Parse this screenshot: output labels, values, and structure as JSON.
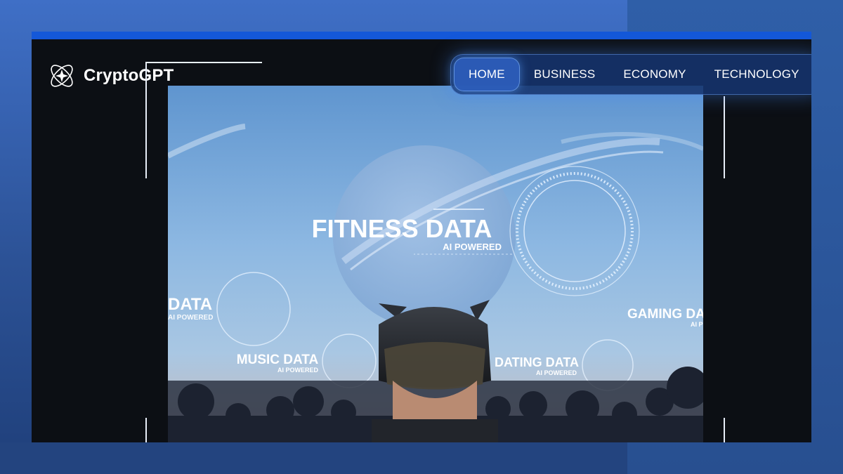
{
  "brand": {
    "name": "CryptoGPT",
    "logo_icon": "atom-star-icon"
  },
  "nav": {
    "items": [
      {
        "label": "HOME",
        "active": true
      },
      {
        "label": "BUSINESS",
        "active": false
      },
      {
        "label": "ECONOMY",
        "active": false
      },
      {
        "label": "TECHNOLOGY",
        "active": false
      }
    ]
  },
  "video": {
    "overlays": {
      "fitness": {
        "title": "FITNESS DATA",
        "subtitle": "AI POWERED"
      },
      "left_data": {
        "title": "DATA",
        "subtitle": "AI POWERED"
      },
      "music": {
        "title": "MUSIC DATA",
        "subtitle": "AI POWERED"
      },
      "dating": {
        "title": "DATING DATA",
        "subtitle": "AI POWERED"
      },
      "gaming": {
        "title": "GAMING DA",
        "subtitle": "AI P"
      }
    }
  },
  "colors": {
    "page_background": "#2c5296",
    "window_background": "#0c0f14",
    "window_topbar": "#1458d8",
    "nav_background": "#16346e",
    "nav_glow": "#468cff"
  }
}
